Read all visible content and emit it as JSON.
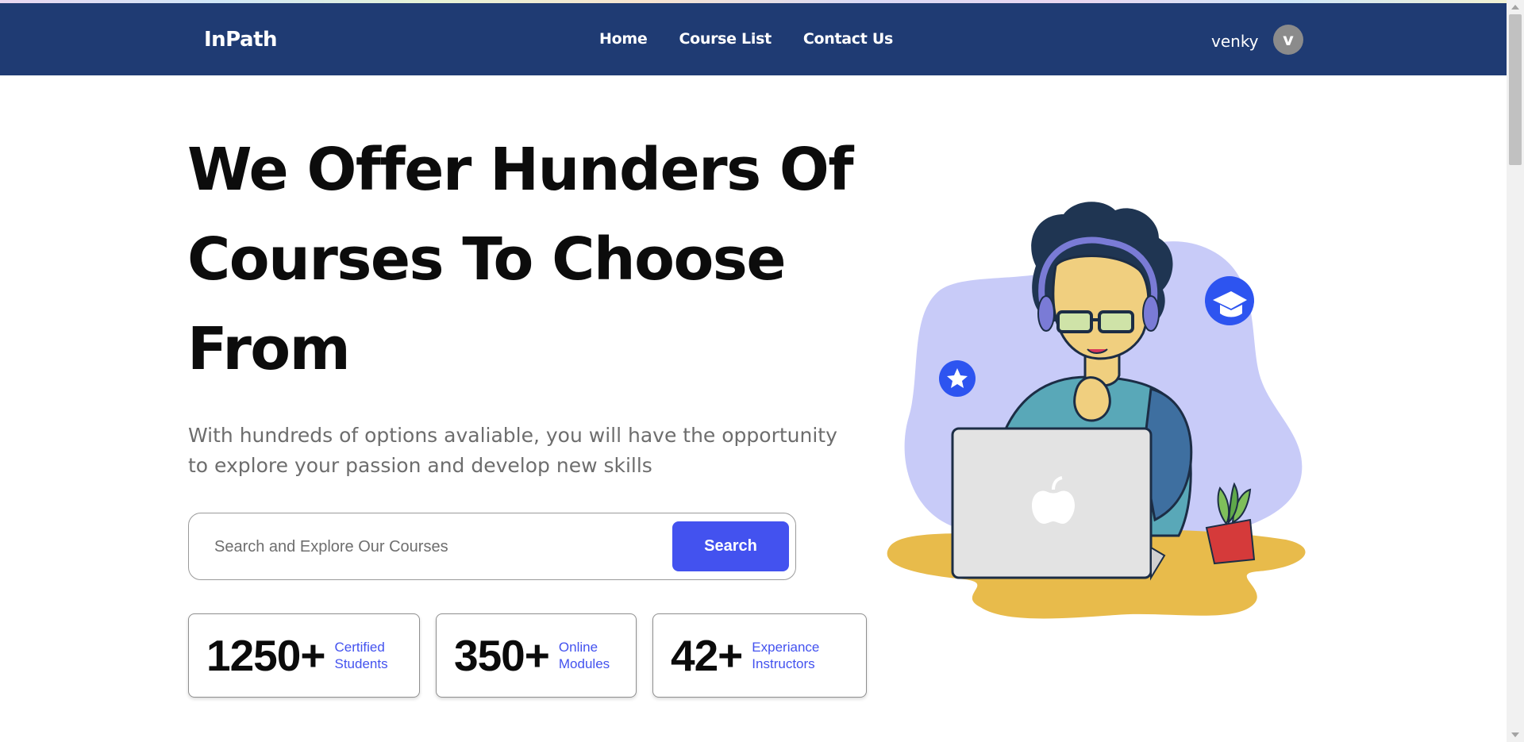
{
  "navbar": {
    "brand": "InPath",
    "links": [
      "Home",
      "Course List",
      "Contact Us"
    ],
    "user_name": "venky",
    "avatar_letter": "v",
    "bg_color": "#1f3b73"
  },
  "hero": {
    "title_lines": [
      "We Offer Hunders Of",
      "Courses To Choose",
      "From"
    ],
    "subtitle": "With hundreds of options avaliable, you will have the opportunity to explore your passion and develop new skills"
  },
  "search": {
    "placeholder": "Search and Explore Our Courses",
    "value": "",
    "button_label": "Search",
    "accent_color": "#4352ef"
  },
  "stats": [
    {
      "number": "1250+",
      "label_line1": "Certified",
      "label_line2": "Students"
    },
    {
      "number": "350+",
      "label_line1": "Online",
      "label_line2": "Modules"
    },
    {
      "number": "42+",
      "label_line1": "Experiance",
      "label_line2": "Instructors"
    }
  ],
  "illustration": {
    "icons": [
      "star-icon",
      "graduation-cap-icon",
      "apple-logo-icon",
      "plant-icon"
    ]
  }
}
